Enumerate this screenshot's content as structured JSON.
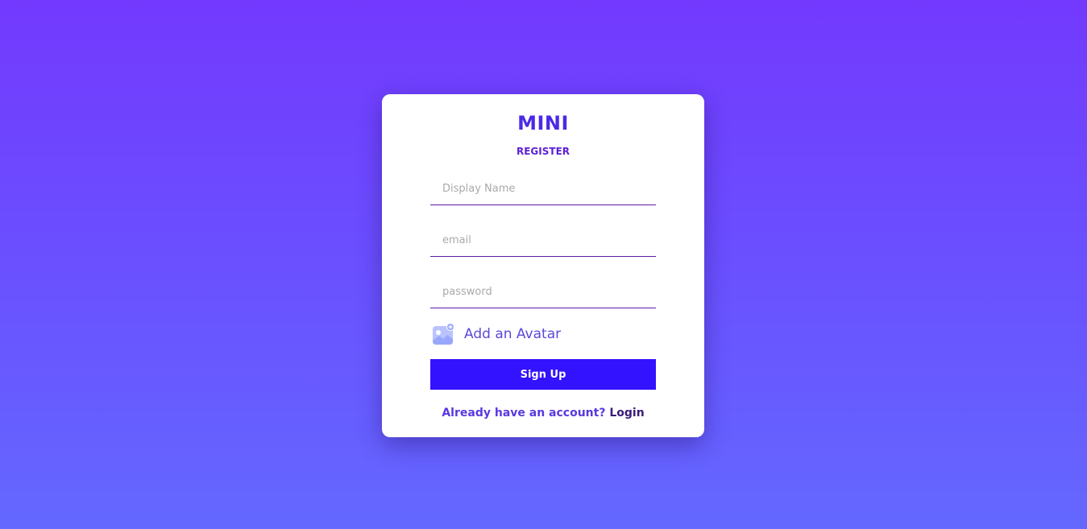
{
  "brand": {
    "logo": "MINI",
    "subtitle": "REGISTER"
  },
  "form": {
    "display_name": {
      "placeholder": "Display Name",
      "value": ""
    },
    "email": {
      "placeholder": "email",
      "value": ""
    },
    "password": {
      "placeholder": "password",
      "value": ""
    },
    "avatar": {
      "label": "Add an Avatar",
      "icon": "add-image-icon"
    },
    "submit_label": "Sign Up"
  },
  "footer": {
    "prompt": "Already have an account?",
    "link_label": "Login"
  },
  "colors": {
    "background_top": "#7339fe",
    "background_bottom": "#6468ff",
    "accent": "#4b2ae6",
    "button": "#3312ff",
    "input_border": "#5d1aa6"
  }
}
